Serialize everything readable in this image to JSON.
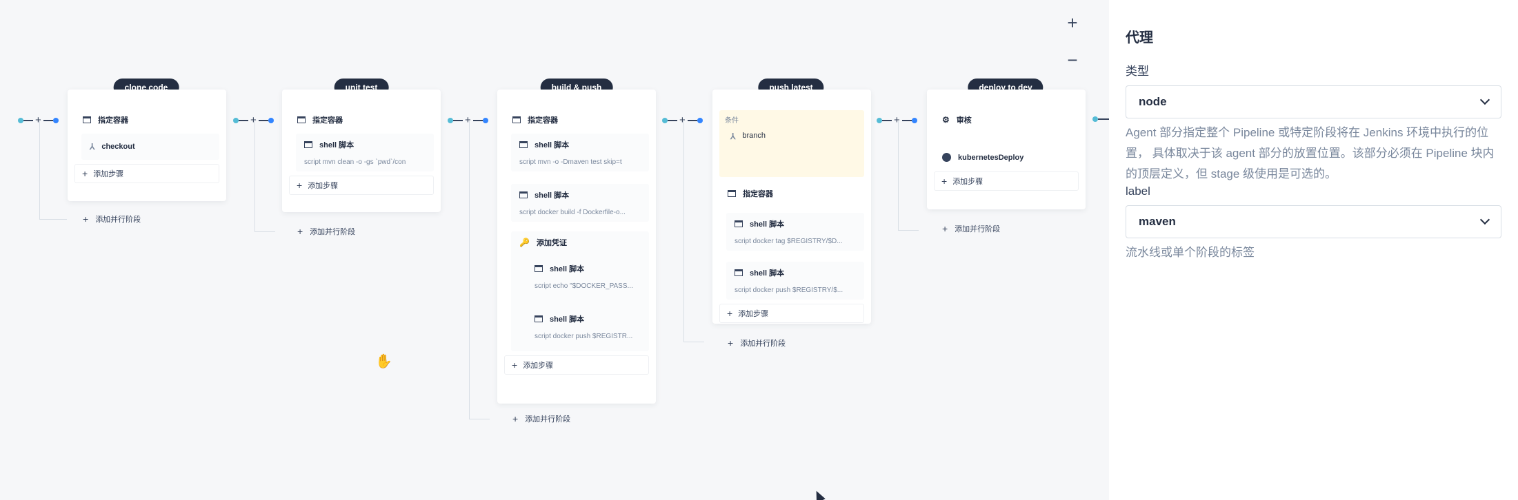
{
  "zoom": {
    "in": "+",
    "out": "−"
  },
  "stages": [
    {
      "title": "clone code",
      "steps": [
        {
          "label": "指定容器",
          "icon": "container-icon"
        },
        {
          "label": "checkout",
          "icon": "branch-icon"
        }
      ],
      "add_step": "添加步骤",
      "add_parallel": "添加并行阶段"
    },
    {
      "title": "unit test",
      "steps": [
        {
          "label": "指定容器"
        },
        {
          "label": "shell 脚本",
          "script": "script   mvn clean -o -gs `pwd`/con"
        }
      ],
      "add_step": "添加步骤",
      "add_parallel": "添加并行阶段"
    },
    {
      "title": "build & push",
      "steps": [
        {
          "label": "指定容器"
        },
        {
          "label": "shell 脚本",
          "script": "script   mvn -o -Dmaven test skip=t"
        },
        {
          "label": "shell 脚本",
          "script": "script   docker build -f Dockerfile-o..."
        },
        {
          "label": "添加凭证"
        },
        {
          "label": "shell 脚本",
          "script": "script   echo \"$DOCKER_PASS..."
        },
        {
          "label": "shell 脚本",
          "script": "script   docker push $REGISTR..."
        }
      ],
      "add_step": "添加步骤",
      "add_parallel": "添加并行阶段"
    },
    {
      "title": "push latest",
      "condition_label": "条件",
      "condition": "branch",
      "steps": [
        {
          "label": "指定容器"
        },
        {
          "label": "shell 脚本",
          "script": "script   docker tag $REGISTRY/$D..."
        },
        {
          "label": "shell 脚本",
          "script": "script   docker push $REGISTRY/$..."
        }
      ],
      "add_step": "添加步骤",
      "add_parallel": "添加并行阶段"
    },
    {
      "title": "deploy to dev",
      "steps": [
        {
          "label": "审核"
        },
        {
          "label": "kubernetesDeploy"
        }
      ],
      "add_step": "添加步骤",
      "add_parallel": "添加并行阶段"
    }
  ],
  "panel": {
    "title": "代理",
    "type_label": "类型",
    "type_value": "node",
    "type_help": "Agent 部分指定整个 Pipeline 或特定阶段将在 Jenkins 环境中执行的位置， 具体取决于该 agent 部分的放置位置。该部分必须在 Pipeline 块内的顶层定义，但 stage 级使用是可选的。",
    "label_label": "label",
    "label_value": "maven",
    "label_help": "流水线或单个阶段的标签"
  },
  "colors": {
    "dark": "#242e42",
    "accent": "#3385ff",
    "condition_bg": "#fff9e6"
  }
}
